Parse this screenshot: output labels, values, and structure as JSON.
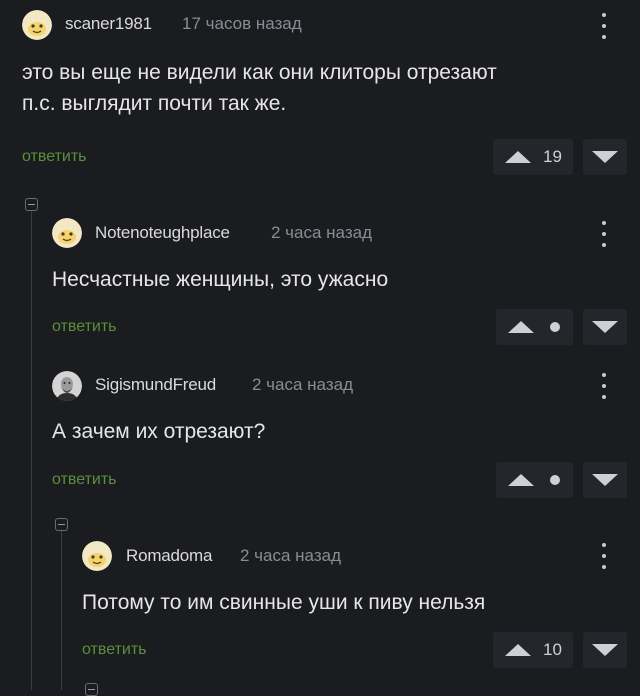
{
  "comments": [
    {
      "username": "scaner1981",
      "time": "17 часов назад",
      "text_lines": [
        "это вы еще не видели как они клиторы отрезают",
        "п.с. выглядит почти так же."
      ],
      "reply_label": "ответить",
      "score": "19",
      "avatar_icon": "pikabu-face-avatar"
    },
    {
      "username": "Notenoteughplace",
      "time": "2 часа назад",
      "text_lines": [
        "Несчастные женщины, это ужасно"
      ],
      "reply_label": "ответить",
      "score": "",
      "avatar_icon": "pikabu-face-avatar"
    },
    {
      "username": "SigismundFreud",
      "time": "2 часа назад",
      "text_lines": [
        "А зачем их отрезают?"
      ],
      "reply_label": "ответить",
      "score": "",
      "avatar_icon": "freud-portrait-avatar"
    },
    {
      "username": "Romadoma",
      "time": "2 часа назад",
      "text_lines": [
        "Потому то им свинные уши к пиву нельзя"
      ],
      "reply_label": "ответить",
      "score": "10",
      "avatar_icon": "pikabu-face-avatar"
    }
  ],
  "colors": {
    "background": "#1b1c20",
    "reply_link": "#5b8f3a",
    "vote_box": "#25262b"
  }
}
